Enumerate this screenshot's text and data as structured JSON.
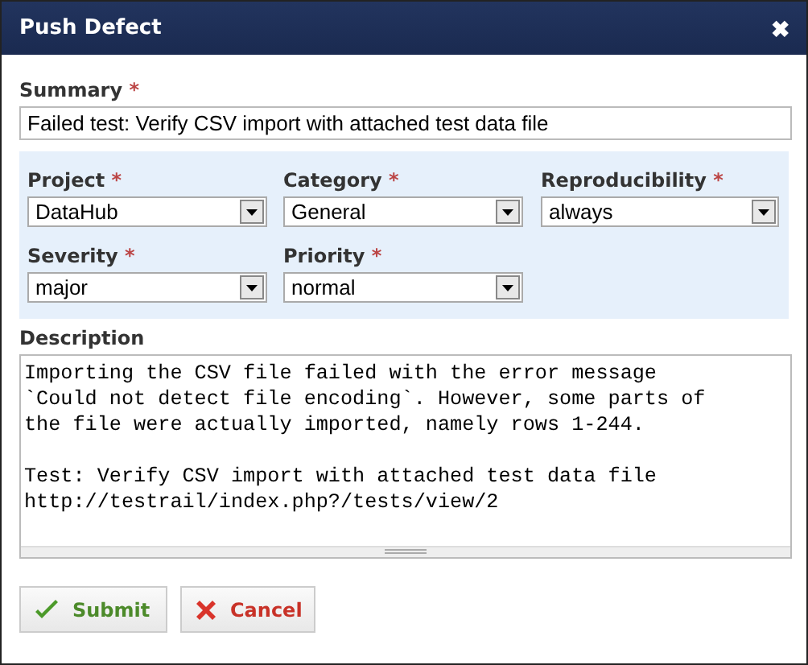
{
  "window": {
    "title": "Push Defect",
    "close": "✖"
  },
  "summary": {
    "label": "Summary",
    "required_mark": "*",
    "value": "Failed test: Verify CSV import with attached test data file"
  },
  "fields": [
    {
      "label": "Project",
      "required_mark": "*",
      "value": "DataHub"
    },
    {
      "label": "Category",
      "required_mark": "*",
      "value": "General"
    },
    {
      "label": "Reproducibility",
      "required_mark": "*",
      "value": "always"
    },
    {
      "label": "Severity",
      "required_mark": "*",
      "value": "major"
    },
    {
      "label": "Priority",
      "required_mark": "*",
      "value": "normal"
    }
  ],
  "description": {
    "label": "Description",
    "paragraphs": [
      [
        "Importing the CSV file failed with the error message",
        "`Could not detect file encoding`. However, some parts of",
        "the file were actually imported, namely rows 1-244."
      ],
      [
        "Test: Verify CSV import with attached test data file",
        "http://testrail/index.php?/tests/view/2"
      ]
    ]
  },
  "buttons": [
    {
      "kind": "submit",
      "label": "Submit"
    },
    {
      "kind": "cancel",
      "label": "Cancel"
    }
  ]
}
